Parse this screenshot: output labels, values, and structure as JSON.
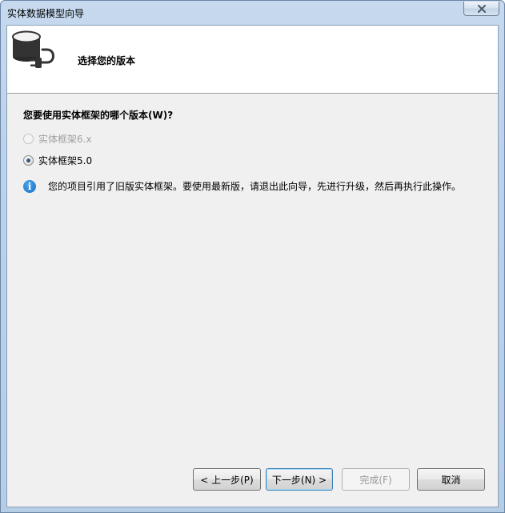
{
  "window": {
    "title": "实体数据模型向导"
  },
  "header": {
    "title": "选择您的版本",
    "icon": "database-plug-icon"
  },
  "question": "您要使用实体框架的哪个版本(W)?",
  "options": [
    {
      "label": "实体框架6.x",
      "enabled": false,
      "checked": false
    },
    {
      "label": "实体框架5.0",
      "enabled": true,
      "checked": true
    }
  ],
  "info": {
    "icon": "info-icon",
    "symbol": "i",
    "text": "您的项目引用了旧版实体框架。要使用最新版，请退出此向导，先进行升级，然后再执行此操作。"
  },
  "buttons": {
    "back": "< 上一步(P)",
    "next": "下一步(N) >",
    "finish": "完成(F)",
    "cancel": "取消"
  },
  "colors": {
    "info_blue": "#1a6fc4",
    "primary_border": "#3c7fb1"
  }
}
